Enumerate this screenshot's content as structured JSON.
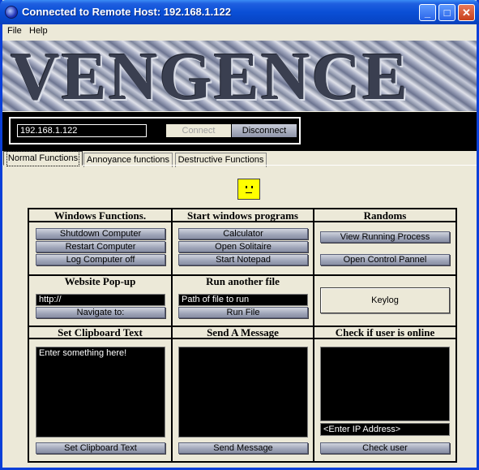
{
  "window": {
    "title": "Connected to Remote Host: 192.168.1.122"
  },
  "menu": {
    "file": "File",
    "help": "Help"
  },
  "banner": {
    "text": "VENGENCE"
  },
  "connection": {
    "host": "192.168.1.122",
    "connect_label": "Connect",
    "disconnect_label": "Disconnect"
  },
  "tabs": [
    {
      "label": "Normal Functions"
    },
    {
      "label": "Annoyance functions"
    },
    {
      "label": "Destructive Functions"
    }
  ],
  "sections": {
    "windows": {
      "title": "Windows Functions.",
      "buttons": [
        "Shutdown Computer",
        "Restart Computer",
        "Log Computer off"
      ]
    },
    "programs": {
      "title": "Start windows programs",
      "buttons": [
        "Calculator",
        "Open Solitaire",
        "Start Notepad"
      ]
    },
    "randoms": {
      "title": "Randoms",
      "buttons": [
        "View Running Process",
        "Open Control Pannel"
      ]
    },
    "popup": {
      "title": "Website Pop-up",
      "url": "http://",
      "button": "Navigate to:"
    },
    "runfile": {
      "title": "Run another file",
      "path": "Path of file to run",
      "button": "Run File"
    },
    "keylog": {
      "button": "Keylog"
    },
    "clipboard": {
      "title": "Set Clipboard Text",
      "text": "Enter something here!",
      "button": "Set Clipboard Text"
    },
    "message": {
      "title": "Send A Message",
      "text": "",
      "button": "Send Message"
    },
    "online": {
      "title": "Check if user is online",
      "ip_placeholder": "<Enter IP Address>",
      "button": "Check user"
    }
  },
  "colors": {
    "title_bar": "#0A4FD6",
    "background": "#ECE9D8",
    "smiley": "#FFFF00"
  }
}
